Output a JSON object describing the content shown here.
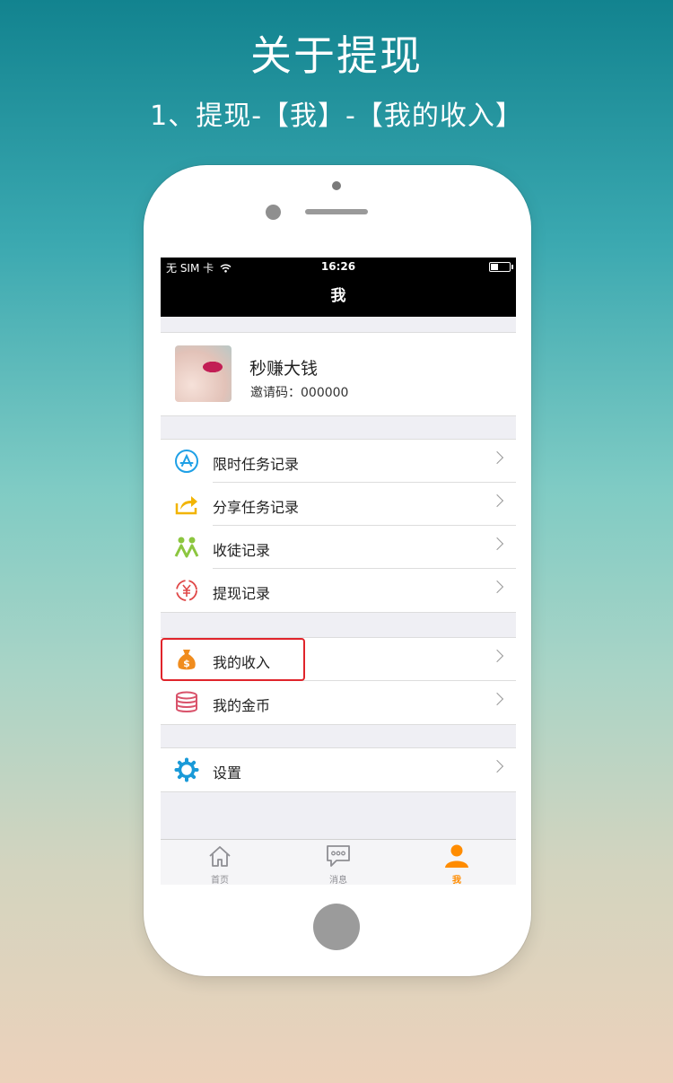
{
  "header": {
    "title": "关于提现",
    "subtitle": "1、提现-【我】-【我的收入】"
  },
  "statusbar": {
    "carrier": "无 SIM 卡",
    "time": "16:26"
  },
  "navbar": {
    "title": "我"
  },
  "profile": {
    "name": "秒赚大钱",
    "invite_code": "邀请码：000000"
  },
  "menu_groups": [
    {
      "items": [
        {
          "label": "限时任务记录",
          "icon": "app-store-icon"
        },
        {
          "label": "分享任务记录",
          "icon": "share-icon"
        },
        {
          "label": "收徒记录",
          "icon": "people-icon"
        },
        {
          "label": "提现记录",
          "icon": "yen-exchange-icon"
        }
      ]
    },
    {
      "items": [
        {
          "label": "我的收入",
          "icon": "money-bag-icon"
        },
        {
          "label": "我的金币",
          "icon": "coin-stack-icon"
        }
      ]
    },
    {
      "items": [
        {
          "label": "设置",
          "icon": "gear-icon"
        }
      ]
    }
  ],
  "tabbar": {
    "tabs": [
      {
        "label": "首页",
        "icon": "home-icon"
      },
      {
        "label": "消息",
        "icon": "message-icon"
      },
      {
        "label": "我",
        "icon": "person-icon",
        "active": true
      }
    ]
  },
  "colors": {
    "accent": "#ff8c00",
    "highlight_box": "#e0242b",
    "navbar": "#000000"
  }
}
